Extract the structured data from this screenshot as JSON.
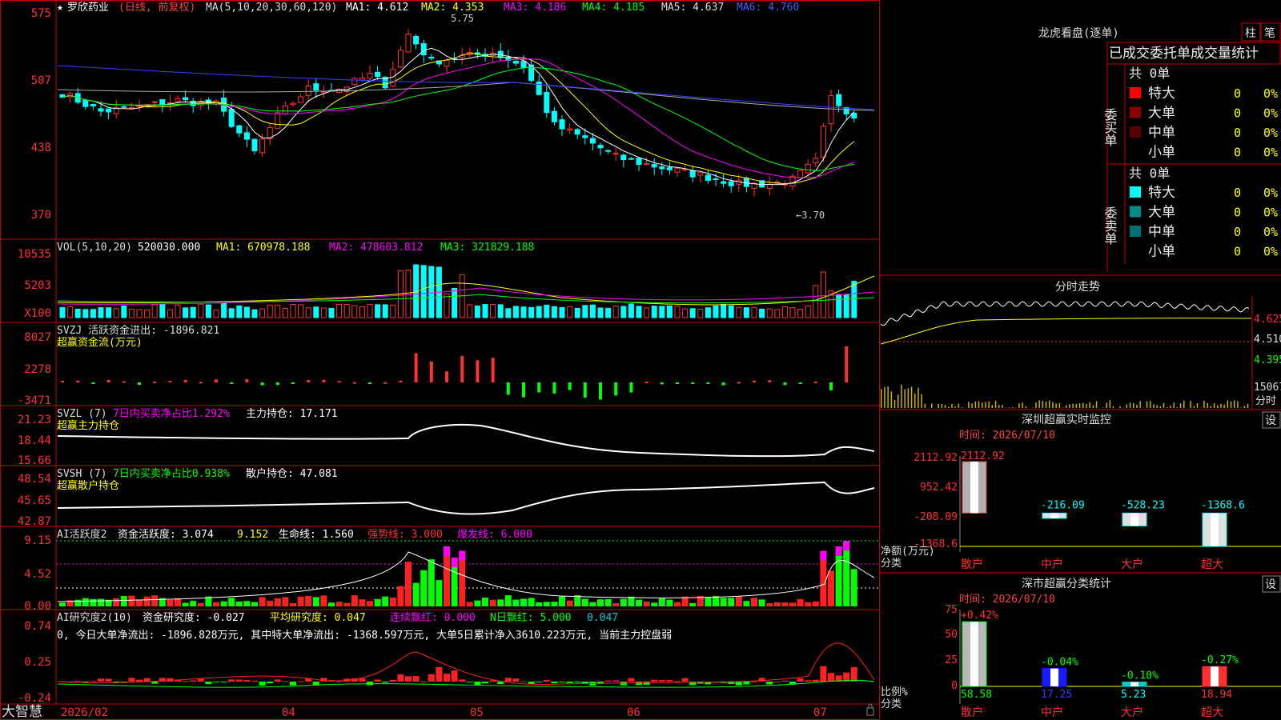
{
  "stock": {
    "star": "★",
    "name": "罗欣药业",
    "mode": "(日线, 前复权)"
  },
  "ma_header": {
    "label": "MA(5,10,20,30,60,120)",
    "ma1": "MA1: 4.612",
    "ma2": "MA2: 4.353",
    "ma3": "MA3: 4.186",
    "ma4": "MA4: 4.185",
    "ma5": "MA5: 4.637",
    "ma6": "MA6: 4.760"
  },
  "price_marks": {
    "high": "5.75",
    "low": "←3.70"
  },
  "price_axis": [
    "575",
    "507",
    "438",
    "370"
  ],
  "vol": {
    "label": "VOL(5,10,20)",
    "value": "520030.000",
    "ma1": "MA1: 670978.188",
    "ma2": "MA2: 478603.812",
    "ma3": "MA3: 321829.188",
    "axis": [
      "10535",
      "5203",
      "X100"
    ]
  },
  "svzj": {
    "title": "SVZJ  活跃资金进出: -1896.821",
    "subtitle": "超赢资金流(万元)",
    "axis": [
      "8027",
      "2278",
      "-3471"
    ]
  },
  "svzl": {
    "title": "SVZL (7)",
    "stat": "7日内买卖净占比1.292%",
    "hold": "主力持仓: 17.171",
    "subtitle": "超赢主力持仓",
    "axis": [
      "21.23",
      "18.44",
      "15.66"
    ]
  },
  "svsh": {
    "title": "SVSH (7)",
    "stat": "7日内买卖净占比0.938%",
    "hold": "散户持仓: 47.081",
    "subtitle": "超赢散户持仓",
    "axis": [
      "48.54",
      "45.65",
      "42.87"
    ]
  },
  "ai1": {
    "title": "AI活跃度2",
    "v1": "资金活跃度: 3.074",
    "v2": "9.152",
    "v3": "生命线: 1.560",
    "v4": "强势线: 3.000",
    "v5": "爆发线: 6.000",
    "axis": [
      "9.15",
      "4.52",
      "0.00"
    ]
  },
  "ai2": {
    "title": "AI研究度2(10)",
    "v1": "资金研究度: -0.027",
    "v2": "平均研究度: 0.047",
    "v3": "连续飘红: 0.000",
    "v4": "N日飘红: 5.000",
    "v5": "0.047",
    "note": "0, 今日大单净流出: -1896.828万元, 其中特大单净流出: -1368.597万元, 大单5日累计净入3610.223万元, 当前主力控盘弱",
    "axis": [
      "0.74",
      "0.25",
      "-0.24"
    ]
  },
  "date_axis": [
    "2026/02",
    "04",
    "05",
    "06",
    "07"
  ],
  "brand": "大智慧",
  "right": {
    "dragon_title": "龙虎看盘(逐单)",
    "btn1": "柱",
    "btn2": "笔",
    "tabs": [
      "已成交",
      "委托单",
      "成交量统计"
    ],
    "buy_label": "委买单",
    "sell_label": "委卖单",
    "buy_total": "共 0单",
    "sell_total": "共 0单",
    "rows_buy": [
      {
        "name": "特大",
        "color": "#ff0000",
        "v": "0",
        "p": "0%"
      },
      {
        "name": "大单",
        "color": "#8b0000",
        "v": "0",
        "p": "0%"
      },
      {
        "name": "中单",
        "color": "#5a0000",
        "v": "0",
        "p": "0%"
      },
      {
        "name": "小单",
        "color": "",
        "v": "0",
        "p": "0%"
      }
    ],
    "rows_sell": [
      {
        "name": "特大",
        "color": "#00ffff",
        "v": "0",
        "p": "0%"
      },
      {
        "name": "大单",
        "color": "#008b8b",
        "v": "0",
        "p": "0%"
      },
      {
        "name": "中单",
        "color": "#006f6f",
        "v": "0",
        "p": "0%"
      },
      {
        "name": "小单",
        "color": "",
        "v": "0",
        "p": "0%"
      }
    ],
    "intraday_title": "分时走势",
    "intraday_axis": [
      "4.625",
      "4.510",
      "4.395"
    ],
    "intraday_vol": "15067",
    "intraday_label": "分时",
    "sz_title": "深圳超赢实时监控",
    "sz_btn": "设",
    "sz_time": "时间: 2026/07/10",
    "sz_axis": [
      "2112.92",
      "952.42",
      "-208.09",
      "-1368.6"
    ],
    "sz_ylabel1": "净额(万元)",
    "sz_ylabel2": "分类",
    "sc_title": "深市超赢分类统计",
    "sc_btn": "设",
    "sc_time": "时间: 2026/07/10",
    "sc_axis": [
      "75",
      "50",
      "25",
      "0"
    ],
    "sc_ylabel1": "比例%",
    "sc_ylabel2": "分类"
  },
  "chart_data": [
    {
      "type": "candlestick",
      "title": "罗欣药业",
      "y_range": [
        3.7,
        5.75
      ],
      "high_mark": 5.75,
      "low_mark": 3.7
    },
    {
      "type": "bar",
      "title": "深圳超赢实时监控",
      "categories": [
        "散户",
        "中户",
        "大户",
        "超大"
      ],
      "values": [
        2112.92,
        -216.09,
        -528.23,
        -1368.6
      ],
      "ylabel": "净额(万元)"
    },
    {
      "type": "bar",
      "title": "深市超赢分类统计",
      "categories": [
        "散户",
        "中户",
        "大户",
        "超大"
      ],
      "values": [
        58.58,
        17.25,
        5.23,
        18.94
      ],
      "changes": [
        "+0.42%",
        "-0.04%",
        "-0.10%",
        "-0.27%"
      ],
      "ylabel": "比例%",
      "ylim": [
        0,
        75
      ]
    }
  ]
}
